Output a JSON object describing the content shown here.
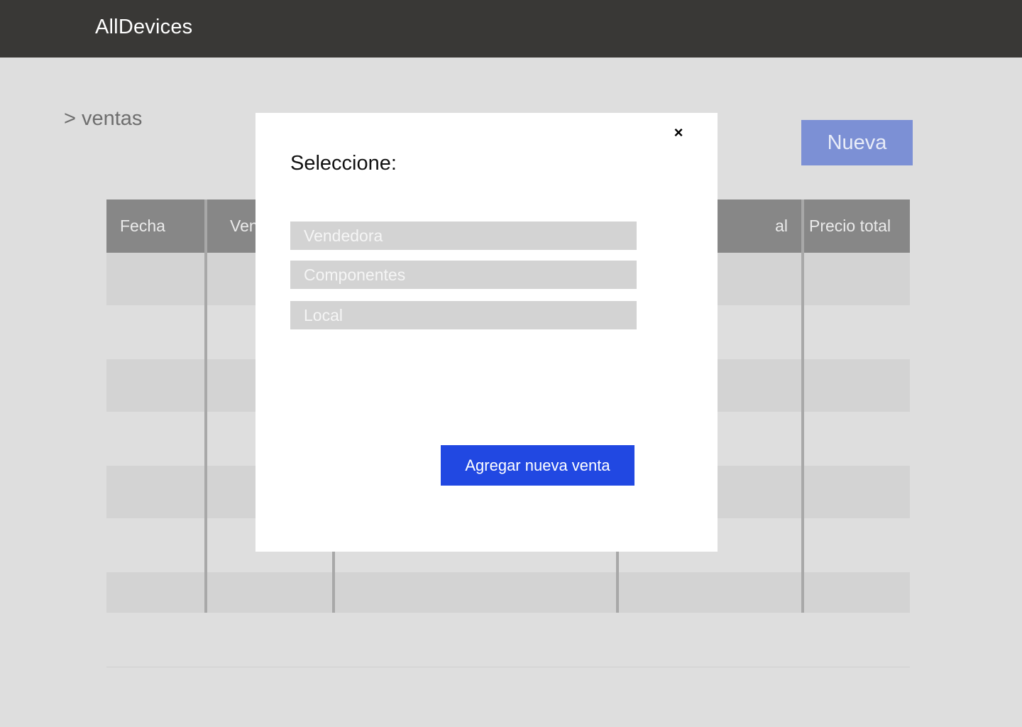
{
  "header": {
    "app_title": "AllDevices"
  },
  "breadcrumb": "> ventas",
  "toolbar": {
    "new_label": "Nueva"
  },
  "table": {
    "columns": [
      "Fecha",
      "Ven",
      "",
      "al",
      "Precio total"
    ]
  },
  "modal": {
    "title": "Seleccione:",
    "close_label": "×",
    "options": [
      "Vendedora",
      "Componentes",
      "Local"
    ],
    "submit_label": "Agregar nueva venta"
  },
  "colors": {
    "topbar": "#393836",
    "accent_button": "#2148e2",
    "new_button": "#7c90d5",
    "table_header": "#878787"
  }
}
